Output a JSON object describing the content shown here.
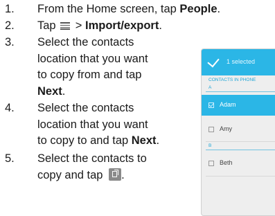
{
  "steps": [
    {
      "num": "1.",
      "lines": [
        [
          "From the Home screen, tap ",
          {
            "b": "People"
          },
          "."
        ]
      ]
    },
    {
      "num": "2.",
      "lines": [
        [
          "Tap ",
          {
            "icon": "menu-icon"
          },
          " > ",
          {
            "b": "Import/export"
          },
          "."
        ]
      ]
    },
    {
      "num": "3.",
      "lines": [
        [
          "Select the contacts"
        ],
        [
          "location that you want"
        ],
        [
          "to copy from and tap"
        ],
        [
          {
            "b": "Next"
          },
          "."
        ]
      ]
    },
    {
      "num": "4.",
      "lines": [
        [
          "Select the contacts"
        ],
        [
          "location that you want"
        ],
        [
          "to copy to and tap ",
          {
            "b": "Next"
          },
          "."
        ]
      ]
    },
    {
      "num": "5.",
      "lines": [
        [
          "Select the contacts to"
        ],
        [
          "copy and tap ",
          {
            "icon": "copy-icon"
          },
          "."
        ]
      ]
    }
  ],
  "phone": {
    "header": "1 selected",
    "section_header": "CONTACTS IN PHONE",
    "sections": [
      {
        "letter": "A",
        "contacts": [
          {
            "name": "Adam",
            "selected": true
          },
          {
            "name": "Amy",
            "selected": false
          }
        ]
      },
      {
        "letter": "B",
        "contacts": [
          {
            "name": "Beth",
            "selected": false
          }
        ]
      }
    ],
    "colors": {
      "accent": "#2bb6e6",
      "section_text": "#1ea5d6",
      "background": "#eeeeee"
    }
  }
}
